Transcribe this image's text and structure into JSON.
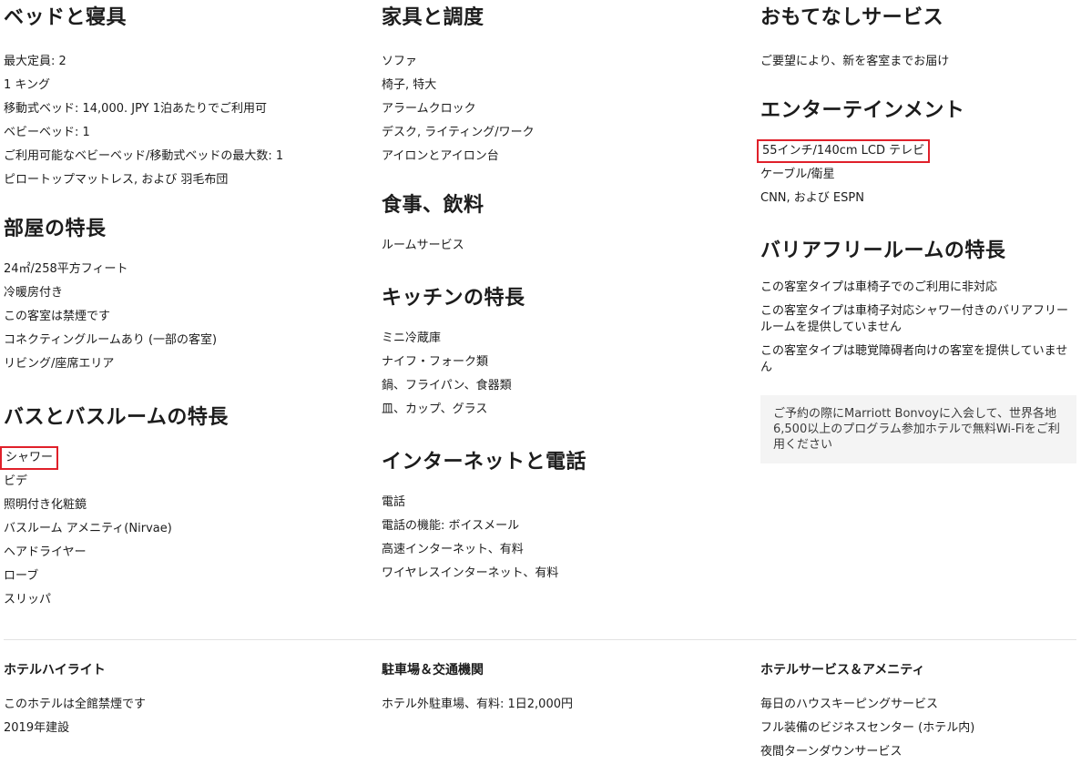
{
  "col1": {
    "bed": {
      "title": "ベッドと寝具",
      "items": [
        "最大定員: 2",
        "1 キング",
        "移動式ベッド: 14,000. JPY 1泊あたりでご利用可",
        "ベビーベッド: 1",
        "ご利用可能なベビーベッド/移動式ベッドの最大数: 1",
        "ピロートップマットレス, および 羽毛布団"
      ]
    },
    "room": {
      "title": "部屋の特長",
      "items": [
        "24㎡/258平方フィート",
        "冷暖房付き",
        "この客室は禁煙です",
        "コネクティングルームあり (一部の客室)",
        "リビング/座席エリア"
      ]
    },
    "bath": {
      "title": "バスとバスルームの特長",
      "items": [
        "シャワー",
        "ビデ",
        "照明付き化粧鏡",
        "バスルーム アメニティ(Nirvae)",
        "ヘアドライヤー",
        "ローブ",
        "スリッパ"
      ]
    }
  },
  "col2": {
    "furniture": {
      "title": "家具と調度",
      "items": [
        "ソファ",
        "椅子, 特大",
        "アラームクロック",
        "デスク, ライティング/ワーク",
        "アイロンとアイロン台"
      ]
    },
    "food": {
      "title": "食事、飲料",
      "items": [
        "ルームサービス"
      ]
    },
    "kitchen": {
      "title": "キッチンの特長",
      "items": [
        "ミニ冷蔵庫",
        "ナイフ・フォーク類",
        "鍋、フライパン、食器類",
        "皿、カップ、グラス"
      ]
    },
    "internet": {
      "title": "インターネットと電話",
      "items": [
        "電話",
        "電話の機能: ボイスメール",
        "高速インターネット、有料",
        "ワイヤレスインターネット、有料"
      ]
    }
  },
  "col3": {
    "hospitality": {
      "title": "おもてなしサービス",
      "items": [
        "ご要望により、新を客室までお届け"
      ]
    },
    "entertainment": {
      "title": "エンターテインメント",
      "items": [
        "55インチ/140cm LCD テレビ",
        "ケーブル/衛星",
        "CNN, および ESPN"
      ]
    },
    "accessible": {
      "title": "バリアフリールームの特長",
      "items": [
        "この客室タイプは車椅子でのご利用に非対応",
        "この客室タイプは車椅子対応シャワー付きのバリアフリールームを提供していません",
        "この客室タイプは聴覚障碍者向けの客室を提供していません"
      ]
    },
    "note": "ご予約の際にMarriott Bonvoyに入会して、世界各地6,500以上のプログラム参加ホテルで無料Wi-Fiをご利用ください"
  },
  "footer": {
    "highlights": {
      "title": "ホテルハイライト",
      "items": [
        "このホテルは全館禁煙です",
        "2019年建設"
      ]
    },
    "parking": {
      "title": "駐車場＆交通機関",
      "items": [
        "ホテル外駐車場、有料: 1日2,000円"
      ]
    },
    "services": {
      "title": "ホテルサービス＆アメニティ",
      "items": [
        "毎日のハウスキーピングサービス",
        "フル装備のビジネスセンター (ホテル内)",
        "夜間ターンダウンサービス"
      ]
    }
  },
  "highlight_color": "#e0202a"
}
